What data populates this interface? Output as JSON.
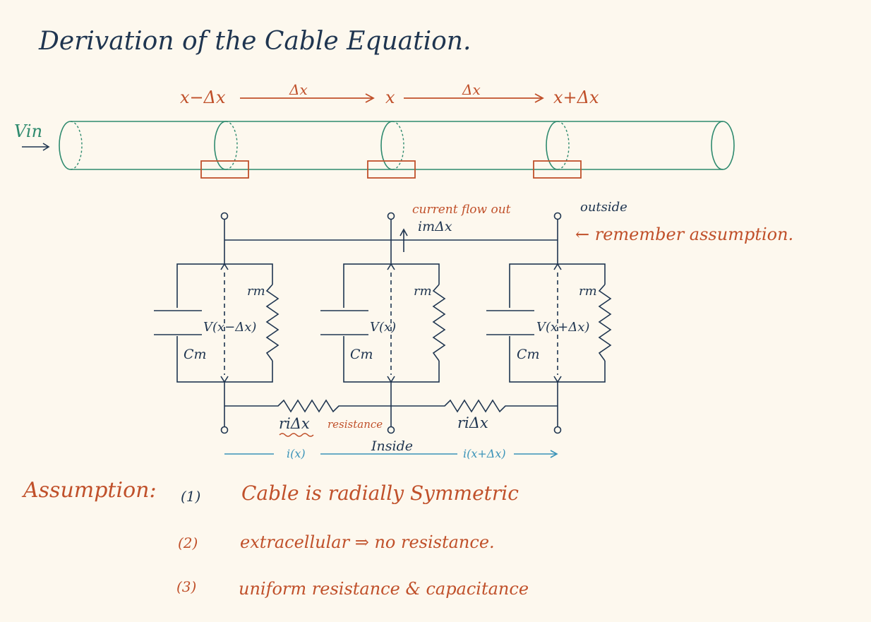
{
  "title": "Derivation of the Cable Equation.",
  "colors": {
    "background": "#fdf8ee",
    "ink": "#1f3550",
    "orange": "#c0502a",
    "green": "#2e8a6e",
    "blue": "#3a93b8"
  },
  "axis": {
    "left": "x−Δx",
    "center": "x",
    "right": "x+Δx",
    "delta1": "Δx",
    "delta2": "Δx"
  },
  "cable": {
    "input_label": "Vin"
  },
  "circuit": {
    "units": [
      {
        "rm": "rm",
        "cm": "Cm",
        "v": "V(x−Δx)"
      },
      {
        "rm": "rm",
        "cm": "Cm",
        "v": "V(x)"
      },
      {
        "rm": "rm",
        "cm": "Cm",
        "v": "V(x+Δx)"
      }
    ],
    "ri_left": "riΔx",
    "ri_right": "riΔx",
    "resistance_note": "resistance",
    "current_flow_out": "current flow out",
    "im_label": "imΔx",
    "outside": "outside",
    "inside": "Inside",
    "remember": "← remember assumption.",
    "i_left": "i(x)",
    "i_right": "i(x+Δx)"
  },
  "assumptions": {
    "heading": "Assumption:",
    "items": [
      {
        "num": "(1)",
        "text": "Cable is radially Symmetric"
      },
      {
        "num": "(2)",
        "text": "extracellular ⇒ no resistance."
      },
      {
        "num": "(3)",
        "text": "uniform resistance & capacitance"
      }
    ]
  }
}
